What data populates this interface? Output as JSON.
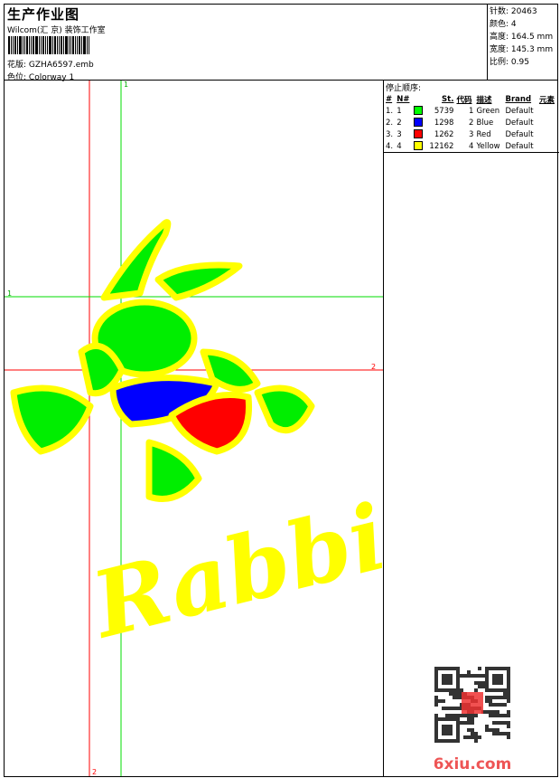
{
  "header": {
    "title": "生产作业图",
    "subtitle": "Wilcom(汇 京) 装饰工作室",
    "file_label": "花版:",
    "file_value": "GZHA6597.emb",
    "colorway_label": "色位:",
    "colorway_value": "Colorway 1"
  },
  "info": [
    {
      "label": "针数:",
      "value": "20463"
    },
    {
      "label": "颜色:",
      "value": "4"
    },
    {
      "label": "高度:",
      "value": "164.5 mm"
    },
    {
      "label": "宽度:",
      "value": "145.3 mm"
    },
    {
      "label": "比例:",
      "value": "0.95"
    }
  ],
  "stop_sequence": {
    "title": "停止顺序:",
    "headers": [
      "#",
      "N#",
      "",
      "St.",
      "代码",
      "描述",
      "Brand",
      "元素"
    ],
    "rows": [
      {
        "idx": "1.",
        "n": "1",
        "color": "#00ff00",
        "st": "5739",
        "code": "1",
        "desc": "Green",
        "brand": "Default"
      },
      {
        "idx": "2.",
        "n": "2",
        "color": "#0000ff",
        "st": "1298",
        "code": "2",
        "desc": "Blue",
        "brand": "Default"
      },
      {
        "idx": "3.",
        "n": "3",
        "color": "#ff0000",
        "st": "1262",
        "code": "3",
        "desc": "Red",
        "brand": "Default"
      },
      {
        "idx": "4.",
        "n": "4",
        "color": "#ffff00",
        "st": "12162",
        "code": "4",
        "desc": "Yellow",
        "brand": "Default"
      }
    ]
  },
  "guides": {
    "v_green": "1",
    "h_green": "1",
    "h_red": "2",
    "v_red": "2"
  },
  "design_text": "Rabbit",
  "watermark": {
    "text": "6xiu.com",
    "seal": "以图版服"
  }
}
